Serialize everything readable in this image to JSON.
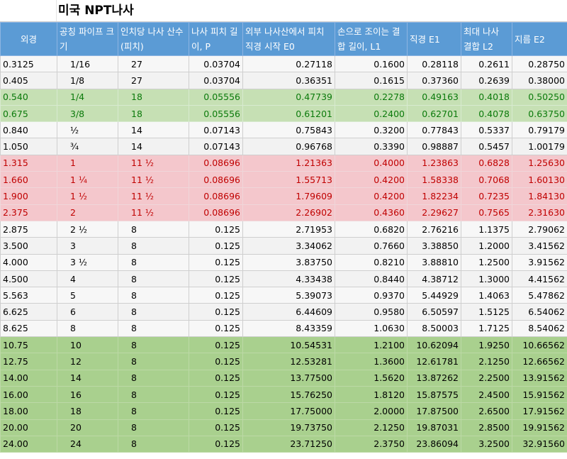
{
  "title": "미국 NPT나사",
  "headers": [
    "외경",
    "공칭 파이프 크기",
    "인치당 나사 산수 (피치)",
    "나사 피치 길이, P",
    "외부 나사산에서 피치 직경 시작 E0",
    "손으로 조이는 결합 길이, L1",
    "직경 E1",
    "최대 나사 결합 L2",
    "지름 E2"
  ],
  "colors": {
    "header_bg": "#5b9bd5",
    "green_bg": "#c6e0b4",
    "green_text": "#0b7a0b",
    "red_bg": "#f4c7cc",
    "red_text": "#c00000",
    "olive_bg": "#a9d08e"
  },
  "rows": [
    {
      "style": "plain",
      "cells": [
        "0.3125",
        "1/16",
        "27",
        "0.03704",
        "0.27118",
        "0.1600",
        "0.28118",
        "0.2611",
        "0.28750"
      ]
    },
    {
      "style": "plain",
      "cells": [
        "0.405",
        "1/8",
        "27",
        "0.03704",
        "0.36351",
        "0.1615",
        "0.37360",
        "0.2639",
        "0.38000"
      ]
    },
    {
      "style": "green",
      "cells": [
        "0.540",
        "1/4",
        "18",
        "0.05556",
        "0.47739",
        "0.2278",
        "0.49163",
        "0.4018",
        "0.50250"
      ]
    },
    {
      "style": "green",
      "cells": [
        "0.675",
        "3/8",
        "18",
        "0.05556",
        "0.61201",
        "0.2400",
        "0.62701",
        "0.4078",
        "0.63750"
      ]
    },
    {
      "style": "plain",
      "cells": [
        "0.840",
        "½",
        "14",
        "0.07143",
        "0.75843",
        "0.3200",
        "0.77843",
        "0.5337",
        "0.79179"
      ]
    },
    {
      "style": "plain",
      "cells": [
        "1.050",
        "¾",
        "14",
        "0.07143",
        "0.96768",
        "0.3390",
        "0.98887",
        "0.5457",
        "1.00179"
      ]
    },
    {
      "style": "red",
      "cells": [
        "1.315",
        "1",
        "11 ½",
        "0.08696",
        "1.21363",
        "0.4000",
        "1.23863",
        "0.6828",
        "1.25630"
      ]
    },
    {
      "style": "red",
      "cells": [
        "1.660",
        "1 ¼",
        "11 ½",
        "0.08696",
        "1.55713",
        "0.4200",
        "1.58338",
        "0.7068",
        "1.60130"
      ]
    },
    {
      "style": "red",
      "cells": [
        "1.900",
        "1 ½",
        "11 ½",
        "0.08696",
        "1.79609",
        "0.4200",
        "1.82234",
        "0.7235",
        "1.84130"
      ]
    },
    {
      "style": "red",
      "cells": [
        "2.375",
        "2",
        "11 ½",
        "0.08696",
        "2.26902",
        "0.4360",
        "2.29627",
        "0.7565",
        "2.31630"
      ]
    },
    {
      "style": "plain",
      "cells": [
        "2.875",
        "2 ½",
        "8",
        "0.125",
        "2.71953",
        "0.6820",
        "2.76216",
        "1.1375",
        "2.79062"
      ]
    },
    {
      "style": "plain",
      "cells": [
        "3.500",
        "3",
        "8",
        "0.125",
        "3.34062",
        "0.7660",
        "3.38850",
        "1.2000",
        "3.41562"
      ]
    },
    {
      "style": "plain",
      "cells": [
        "4.000",
        "3 ½",
        "8",
        "0.125",
        "3.83750",
        "0.8210",
        "3.88810",
        "1.2500",
        "3.91562"
      ]
    },
    {
      "style": "plain",
      "cells": [
        "4.500",
        "4",
        "8",
        "0.125",
        "4.33438",
        "0.8440",
        "4.38712",
        "1.3000",
        "4.41562"
      ]
    },
    {
      "style": "plain",
      "cells": [
        "5.563",
        "5",
        "8",
        "0.125",
        "5.39073",
        "0.9370",
        "5.44929",
        "1.4063",
        "5.47862"
      ]
    },
    {
      "style": "plain",
      "cells": [
        "6.625",
        "6",
        "8",
        "0.125",
        "6.44609",
        "0.9580",
        "6.50597",
        "1.5125",
        "6.54062"
      ]
    },
    {
      "style": "plain",
      "cells": [
        "8.625",
        "8",
        "8",
        "0.125",
        "8.43359",
        "1.0630",
        "8.50003",
        "1.7125",
        "8.54062"
      ]
    },
    {
      "style": "olive",
      "cells": [
        "10.75",
        "10",
        "8",
        "0.125",
        "10.54531",
        "1.2100",
        "10.62094",
        "1.9250",
        "10.66562"
      ]
    },
    {
      "style": "olive",
      "cells": [
        "12.75",
        "12",
        "8",
        "0.125",
        "12.53281",
        "1.3600",
        "12.61781",
        "2.1250",
        "12.66562"
      ]
    },
    {
      "style": "olive",
      "cells": [
        "14.00",
        "14",
        "8",
        "0.125",
        "13.77500",
        "1.5620",
        "13.87262",
        "2.2500",
        "13.91562"
      ]
    },
    {
      "style": "olive",
      "cells": [
        "16.00",
        "16",
        "8",
        "0.125",
        "15.76250",
        "1.8120",
        "15.87575",
        "2.4500",
        "15.91562"
      ]
    },
    {
      "style": "olive",
      "cells": [
        "18.00",
        "18",
        "8",
        "0.125",
        "17.75000",
        "2.0000",
        "17.87500",
        "2.6500",
        "17.91562"
      ]
    },
    {
      "style": "olive",
      "cells": [
        "20.00",
        "20",
        "8",
        "0.125",
        "19.73750",
        "2.1250",
        "19.87031",
        "2.8500",
        "19.91562"
      ]
    },
    {
      "style": "olive",
      "cells": [
        "24.00",
        "24",
        "8",
        "0.125",
        "23.71250",
        "2.3750",
        "23.86094",
        "3.2500",
        "32.91560"
      ]
    }
  ]
}
